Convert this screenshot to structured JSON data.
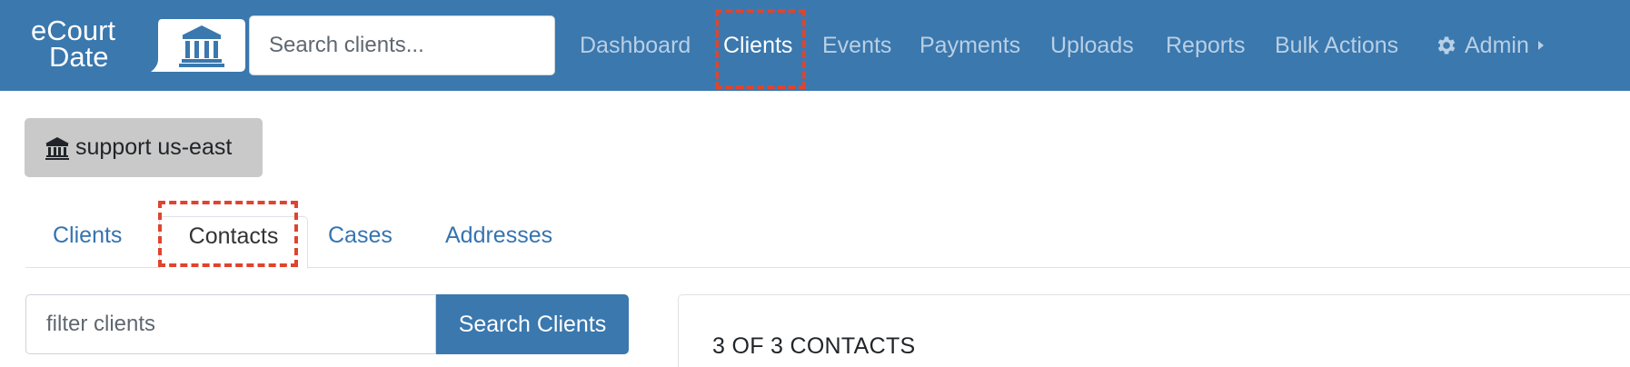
{
  "brand": {
    "line1": "eCourt",
    "line2": "Date",
    "icon": "courthouse-speech-bubble-icon"
  },
  "search": {
    "placeholder": "Search clients..."
  },
  "nav": {
    "dashboard": "Dashboard",
    "clients": "Clients",
    "events": "Events",
    "payments": "Payments",
    "uploads": "Uploads",
    "reports": "Reports",
    "bulk_actions": "Bulk Actions",
    "admin": "Admin",
    "admin_icon": "gear-icon",
    "admin_caret": "caret-right-icon"
  },
  "org": {
    "label": "support us-east",
    "icon": "courthouse-icon"
  },
  "tabs": {
    "clients": "Clients",
    "contacts": "Contacts",
    "cases": "Cases",
    "addresses": "Addresses"
  },
  "filter": {
    "placeholder": "filter clients",
    "button": "Search Clients"
  },
  "results": {
    "count_label": "3 OF 3 CONTACTS"
  },
  "colors": {
    "navbar": "#3a78ae",
    "link": "#3574b0",
    "highlight": "#e0442e",
    "org_button": "#c9c9c9"
  }
}
